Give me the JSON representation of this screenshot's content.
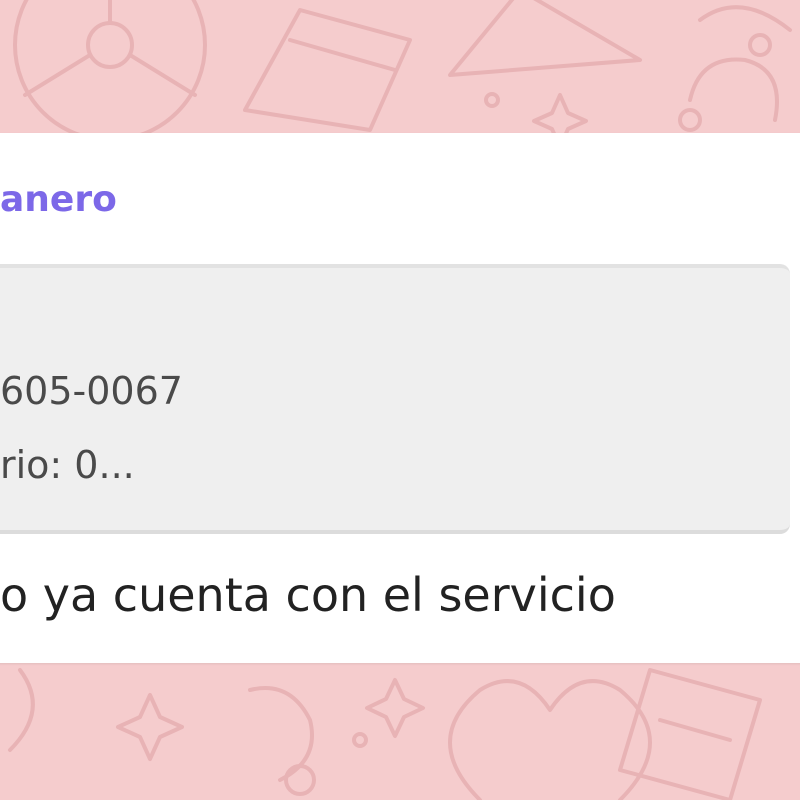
{
  "colors": {
    "background": "#f5cccd",
    "bubble": "#ffffff",
    "quote_background": "#efefef",
    "sender_name": "#7c68e8",
    "text": "#222222"
  },
  "message": {
    "sender_name": "anero",
    "quoted": {
      "line1": "605-0067",
      "line2": "rio: 0..."
    },
    "text": "o ya cuenta con el servicio"
  },
  "wallpaper_icons": [
    "steering-wheel-icon",
    "card-icon",
    "triangle-icon",
    "sparkle-icon",
    "heart-icon",
    "bell-icon",
    "note-icon"
  ]
}
